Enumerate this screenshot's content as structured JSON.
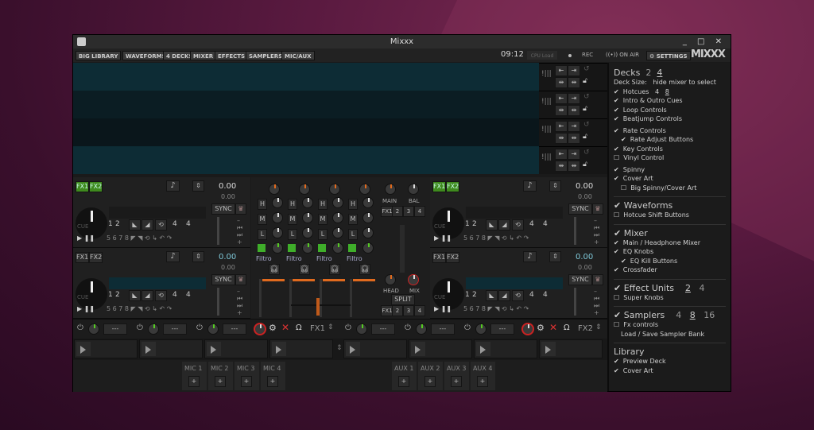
{
  "window": {
    "title": "Mixxx",
    "controls": "_ □ ✕"
  },
  "toolbar": {
    "big_library": "BIG LIBRARY",
    "toggles": [
      "WAVEFORMS",
      "4 DECKS",
      "MIXER",
      "EFFECTS",
      "SAMPLERS",
      "MIC/AUX"
    ],
    "clock": "09:12",
    "cpu_label": "CPU Load",
    "rec": "REC",
    "on_air": "ON AIR",
    "settings": "SETTINGS",
    "logo": "MIXXX"
  },
  "colors": {
    "accent": "#e06a1e",
    "fx_on": "#3f8a1e",
    "waveform": "#0d2c35"
  },
  "decks": [
    {
      "fx": [
        "FX1",
        "FX2"
      ],
      "fx_on": true,
      "bpm": "0.00",
      "rate": "0.00",
      "sync": "SYNC",
      "hotcues": [
        "1",
        "2"
      ],
      "beatloop": [
        "4",
        "4"
      ],
      "cue": "CUE"
    },
    {
      "fx": [
        "FX1",
        "FX2"
      ],
      "fx_on": false,
      "bpm": "0.00",
      "rate": "0.00",
      "sync": "SYNC",
      "hotcues": [
        "1",
        "2"
      ],
      "beatloop": [
        "4",
        "4"
      ],
      "cue": "CUE"
    },
    {
      "fx": [
        "FX1",
        "FX2"
      ],
      "fx_on": true,
      "bpm": "0.00",
      "rate": "0.00",
      "sync": "SYNC",
      "hotcues": [
        "1",
        "2"
      ],
      "beatloop": [
        "4",
        "4"
      ],
      "cue": "CUE"
    },
    {
      "fx": [
        "FX1",
        "FX2"
      ],
      "fx_on": false,
      "bpm": "0.00",
      "rate": "0.00",
      "sync": "SYNC",
      "hotcues": [
        "1",
        "2"
      ],
      "beatloop": [
        "4",
        "4"
      ],
      "cue": "CUE"
    }
  ],
  "mixer": {
    "eq": [
      "H",
      "M",
      "L"
    ],
    "filter": "Filtro",
    "main": "MAIN",
    "bal": "BAL",
    "head": "HEAD",
    "mix": "MIX",
    "split": "SPLIT",
    "fx_assign": [
      "FX1",
      "2",
      "3",
      "4"
    ]
  },
  "effects": {
    "units": [
      {
        "label": "FX1",
        "slots": [
          "---",
          "---",
          "---"
        ]
      },
      {
        "label": "FX2",
        "slots": [
          "---",
          "---",
          "---"
        ]
      }
    ]
  },
  "samplers": {
    "count": 8
  },
  "mic_aux": {
    "mics": [
      "MIC 1",
      "MIC 2",
      "MIC 3",
      "MIC 4"
    ],
    "aux": [
      "AUX 1",
      "AUX 2",
      "AUX 3",
      "AUX 4"
    ],
    "add": "+"
  },
  "panel": {
    "decks_title": "Decks",
    "decks_opts": [
      "2",
      "4"
    ],
    "deck_size": "Deck Size:",
    "deck_size_hint": "hide mixer to select",
    "hotcues": "Hotcues",
    "hotcue_opts": [
      "4",
      "8"
    ],
    "intro_outro": "Intro & Outro Cues",
    "loop": "Loop Controls",
    "beatjump": "Beatjump Controls",
    "rate": "Rate Controls",
    "rate_adjust": "Rate Adjust Buttons",
    "key": "Key Controls",
    "vinyl": "Vinyl Control",
    "spinny": "Spinny",
    "cover_art": "Cover Art",
    "big_spinny": "Big Spinny/Cover Art",
    "waveforms": "Waveforms",
    "hotcue_shift": "Hotcue Shift Buttons",
    "mixer": "Mixer",
    "main_head": "Main / Headphone Mixer",
    "eq_knobs": "EQ Knobs",
    "eq_kill": "EQ Kill Buttons",
    "crossfader": "Crossfader",
    "effect_units": "Effect Units",
    "effect_opts": [
      "2",
      "4"
    ],
    "super_knobs": "Super Knobs",
    "samplers": "Samplers",
    "sampler_opts": [
      "4",
      "8",
      "16"
    ],
    "fx_controls": "Fx controls",
    "load_save": "Load / Save Sampler Bank",
    "library": "Library",
    "preview_deck": "Preview Deck",
    "lib_cover_art": "Cover Art"
  }
}
